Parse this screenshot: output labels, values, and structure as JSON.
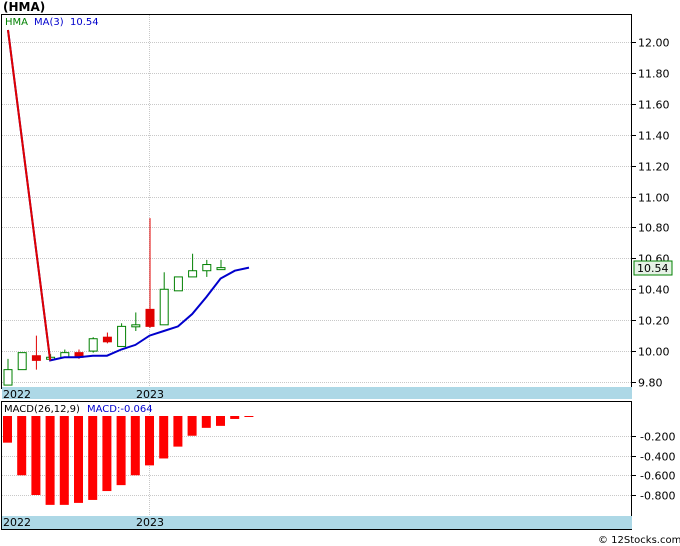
{
  "header": {
    "title": "(HMA)"
  },
  "legend": {
    "ticker": "HMA",
    "ma_label": "MA(3)",
    "ma_value": "10.54",
    "macd_label": "MACD(26,12,9)",
    "macd_value_label": "MACD:-0.064"
  },
  "price_badge": "10.54",
  "footer": {
    "watermark": "© 12Stocks.com"
  },
  "colors": {
    "up": "#008000",
    "down": "#e00000",
    "ma": "#0000cc",
    "macd_bar": "#ff0000",
    "date_band": "#add8e6",
    "price_badge_bg": "#e6f2e6",
    "legend_ticker": "#008000",
    "legend_ma": "#0000cc"
  },
  "chart_data": [
    {
      "type": "candlestick",
      "name": "price",
      "ylim": [
        9.7,
        12.1
      ],
      "yticks": [
        "12.00",
        "11.80",
        "11.60",
        "11.40",
        "11.20",
        "11.00",
        "10.80",
        "10.60",
        "10.40",
        "10.20",
        "10.00",
        "9.80"
      ],
      "x_labels": [
        "2022",
        "2023"
      ],
      "candles": [
        {
          "o": 9.78,
          "h": 9.95,
          "l": 9.78,
          "c": 9.88
        },
        {
          "o": 9.88,
          "h": 9.99,
          "l": 9.9,
          "c": 9.99
        },
        {
          "o": 9.97,
          "h": 10.1,
          "l": 9.88,
          "c": 9.94
        },
        {
          "o": 9.96,
          "h": 9.98,
          "l": 9.94,
          "c": 9.96
        },
        {
          "o": 9.96,
          "h": 10.01,
          "l": 9.96,
          "c": 9.99
        },
        {
          "o": 9.99,
          "h": 10.01,
          "l": 9.95,
          "c": 9.96
        },
        {
          "o": 10.0,
          "h": 10.09,
          "l": 9.99,
          "c": 10.08
        },
        {
          "o": 10.09,
          "h": 10.12,
          "l": 10.05,
          "c": 10.06
        },
        {
          "o": 10.03,
          "h": 10.18,
          "l": 10.03,
          "c": 10.16
        },
        {
          "o": 10.17,
          "h": 10.25,
          "l": 10.13,
          "c": 10.17
        },
        {
          "o": 10.27,
          "h": 10.86,
          "l": 10.15,
          "c": 10.16
        },
        {
          "o": 10.17,
          "h": 10.51,
          "l": 10.17,
          "c": 10.4
        },
        {
          "o": 10.39,
          "h": 10.46,
          "l": 10.39,
          "c": 10.48
        },
        {
          "o": 10.48,
          "h": 10.63,
          "l": 10.48,
          "c": 10.52
        },
        {
          "o": 10.52,
          "h": 10.59,
          "l": 10.48,
          "c": 10.56
        },
        {
          "o": 10.54,
          "h": 10.59,
          "l": 10.54,
          "c": 10.54
        }
      ],
      "ma_series": {
        "name": "MA(3)",
        "values": [
          12.1,
          9.94,
          9.96,
          9.96,
          9.97,
          9.97,
          10.01,
          10.04,
          10.1,
          10.13,
          10.16,
          10.24,
          10.35,
          10.47,
          10.52,
          10.54
        ]
      }
    },
    {
      "type": "bar",
      "name": "MACD(26,12,9)",
      "ylim": [
        -1.0,
        0.0
      ],
      "yticks": [
        "-0.200",
        "-0.400",
        "-0.600",
        "-0.800"
      ],
      "x_labels": [
        "2022",
        "2023"
      ],
      "values": [
        -0.27,
        -0.6,
        -0.8,
        -0.9,
        -0.9,
        -0.88,
        -0.85,
        -0.76,
        -0.7,
        -0.6,
        -0.5,
        -0.43,
        -0.31,
        -0.2,
        -0.12,
        -0.1,
        -0.03,
        -0.01
      ]
    }
  ]
}
